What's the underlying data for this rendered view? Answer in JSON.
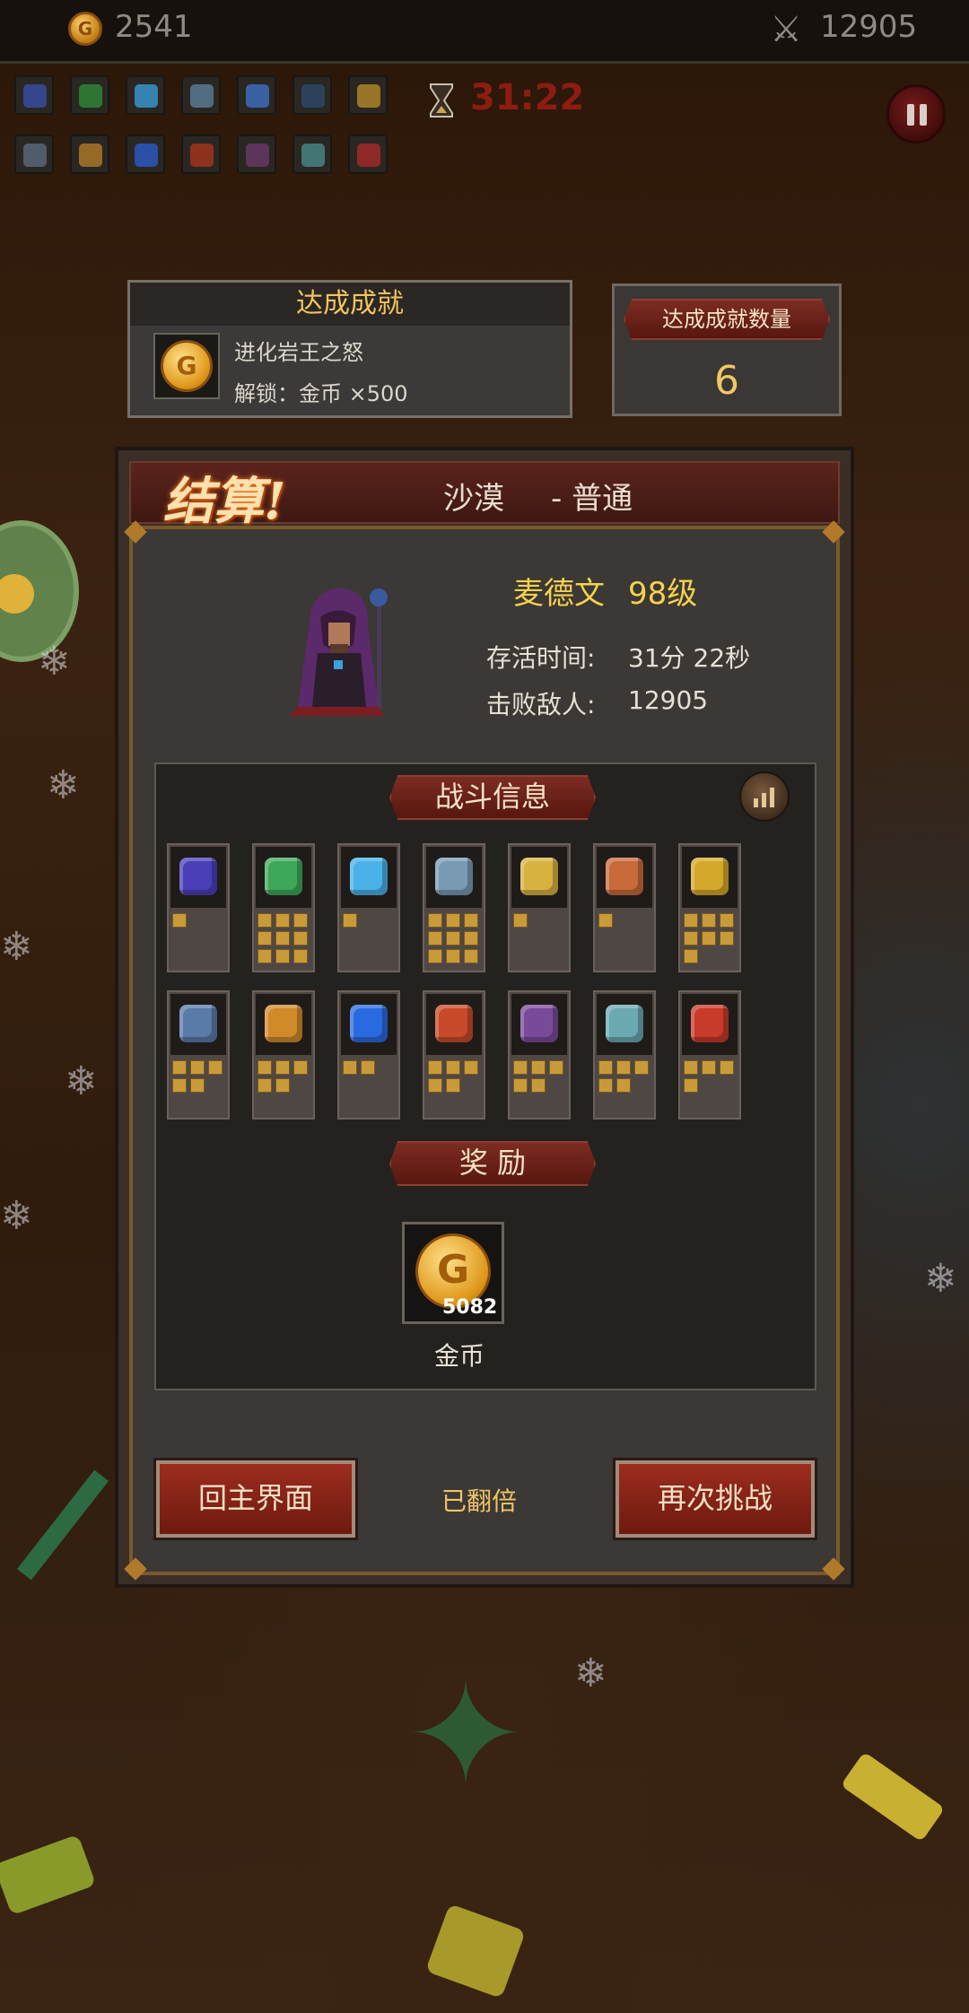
{
  "hud": {
    "gold": "2541",
    "kills": "12905",
    "timer": "31:22",
    "weapon_slots": [
      {
        "name": "claw",
        "color": "#3a4fa8"
      },
      {
        "name": "shuriken",
        "color": "#2f8a3a"
      },
      {
        "name": "crystal-wing",
        "color": "#3a9ad6"
      },
      {
        "name": "axe",
        "color": "#5c7e9a"
      },
      {
        "name": "hammer",
        "color": "#3d6fc2"
      },
      {
        "name": "blade",
        "color": "#2d4a6a"
      },
      {
        "name": "skull-flask",
        "color": "#b58a2a"
      }
    ],
    "passive_slots": [
      {
        "name": "urn",
        "color": "#5a6a80"
      },
      {
        "name": "armor",
        "color": "#b07a28"
      },
      {
        "name": "ring",
        "color": "#2a5ac8"
      },
      {
        "name": "gauntlet",
        "color": "#a8361e"
      },
      {
        "name": "tome",
        "color": "#6a3a6a"
      },
      {
        "name": "necklace",
        "color": "#4a8a8a"
      },
      {
        "name": "helmet",
        "color": "#a82a2a"
      }
    ]
  },
  "achievement": {
    "title": "达成成就",
    "name": "进化岩王之怒",
    "unlock": "解锁：金币 ×500",
    "coin_letter": "G",
    "count_label": "达成成就数量",
    "count": "6"
  },
  "result": {
    "header": "结算!",
    "stage": "沙漠",
    "difficulty": "- 普通",
    "hero_name": "麦德文",
    "hero_level": "98级",
    "survival_label": "存活时间:",
    "survival_value": "31分 22秒",
    "kills_label": "击败敌人:",
    "kills_value": "12905",
    "battle_info_title": "战斗信息",
    "stats_icon": "chart-icon",
    "weapons": [
      {
        "name": "claw",
        "color": "#4b3fb8",
        "level": 1
      },
      {
        "name": "shuriken",
        "color": "#3ea85a",
        "level": 9
      },
      {
        "name": "crystal-wing",
        "color": "#4ab2e8",
        "level": 1
      },
      {
        "name": "axe",
        "color": "#7a9ab4",
        "level": 9
      },
      {
        "name": "hammer",
        "color": "#d8b240",
        "level": 1
      },
      {
        "name": "blade",
        "color": "#c86a3a",
        "level": 1
      },
      {
        "name": "skull-flask",
        "color": "#d4a82a",
        "level": 7
      }
    ],
    "passives": [
      {
        "name": "urn",
        "color": "#5a7aa8",
        "level": 5
      },
      {
        "name": "armor",
        "color": "#d08a2a",
        "level": 5
      },
      {
        "name": "ring",
        "color": "#2a6ae0",
        "level": 2
      },
      {
        "name": "gauntlet",
        "color": "#c84a2a",
        "level": 5
      },
      {
        "name": "tome",
        "color": "#7a4a9a",
        "level": 5
      },
      {
        "name": "necklace",
        "color": "#6aaab0",
        "level": 5
      },
      {
        "name": "helmet",
        "color": "#c83a2a",
        "level": 4
      }
    ],
    "reward_title": "奖 励",
    "reward_amount": "5082",
    "reward_label": "金币",
    "reward_coin_letter": "G",
    "main_menu_label": "回主界面",
    "doubled_label": "已翻倍",
    "retry_label": "再次挑战"
  }
}
